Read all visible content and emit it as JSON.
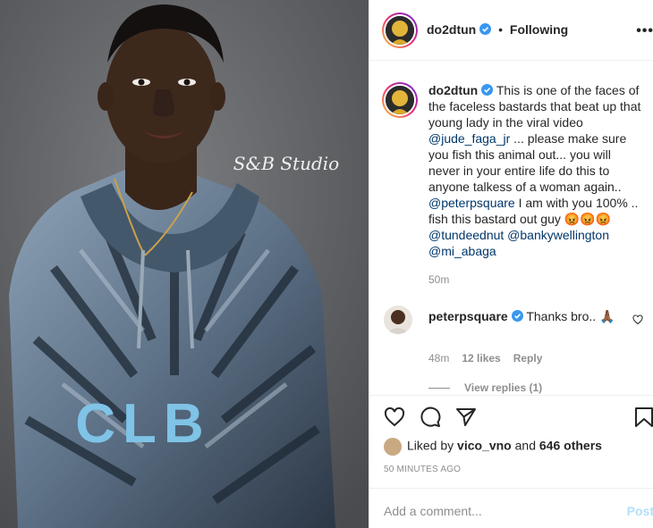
{
  "header": {
    "username": "do2dtun",
    "separator": "•",
    "follow_status": "Following",
    "more_label": "•••"
  },
  "photo": {
    "watermark": "S&B Studio",
    "shirt_text": "CLB"
  },
  "caption": {
    "username": "do2dtun",
    "text1": " This is one of the faces of the faceless bastards that beat up that young lady in the viral video ",
    "mention1": "@jude_faga_jr",
    "text2": " ... please make sure you fish this animal out... you will never in your entire life do this to anyone talkess of a woman again.. ",
    "mention2": "@peterpsquare",
    "text3": " I am with you 100% .. fish this bastard out guy 😡😡😡 ",
    "mention3": "@tundeednut",
    "mention4": "@bankywellington",
    "mention5": "@mi_abaga",
    "time": "50m"
  },
  "comment": {
    "username": "peterpsquare",
    "text": " Thanks bro.. 🙏🏾",
    "time": "48m",
    "likes": "12 likes",
    "reply": "Reply",
    "view_replies": "View replies (1)"
  },
  "likes": {
    "prefix": "Liked by ",
    "user": "vico_vno",
    "middle": " and ",
    "others": "646 others"
  },
  "timestamp": "50 MINUTES AGO",
  "add_comment": {
    "placeholder": "Add a comment...",
    "post": "Post"
  },
  "colors": {
    "verified": "#3897f0",
    "link": "#00376b",
    "muted": "#8e8e8e",
    "post_disabled": "#b2dffc"
  }
}
